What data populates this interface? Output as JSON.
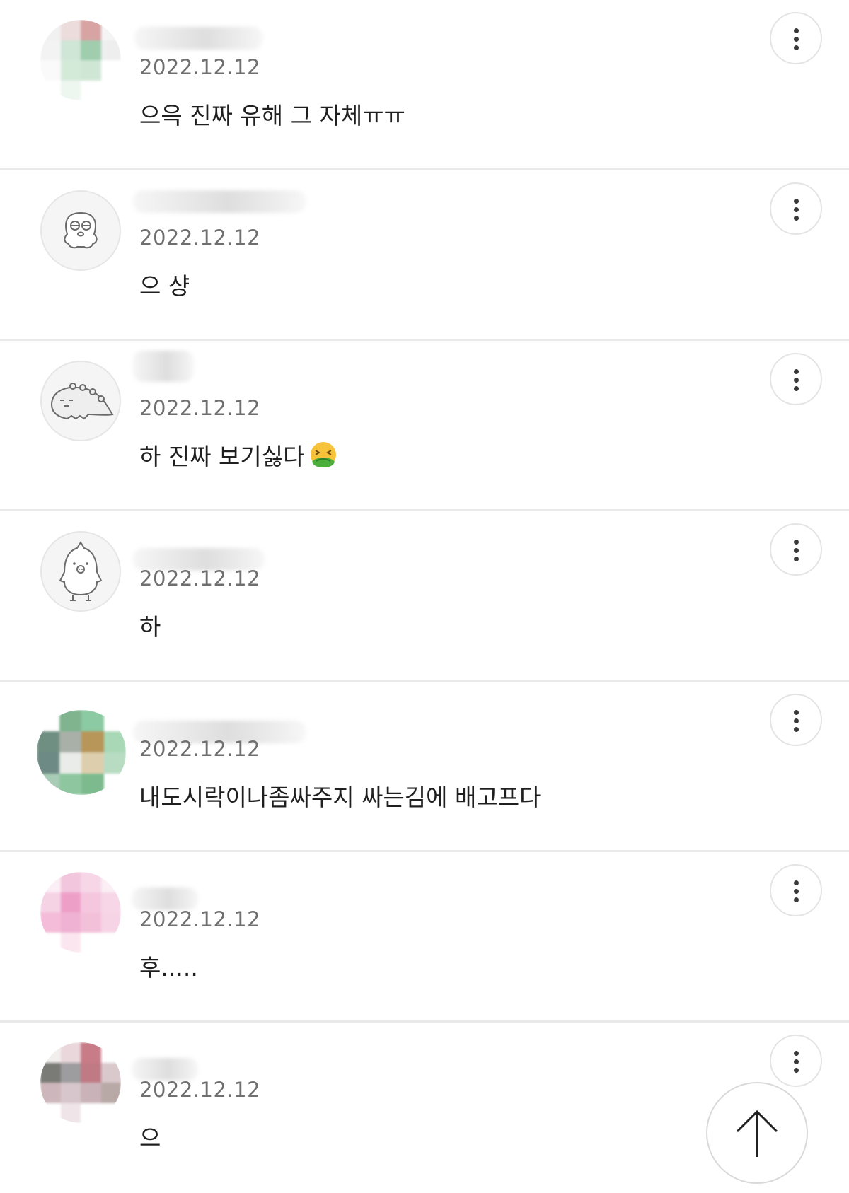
{
  "comments": [
    {
      "avatar": "photo-mosaic-green-red",
      "nickname_hidden": true,
      "date": "2022.12.12",
      "text": "으윽 진짜 유해 그 자체ㅠㅠ"
    },
    {
      "avatar": "character-face-icon",
      "nickname_hidden": true,
      "date": "2022.12.12",
      "text": "으 샹"
    },
    {
      "avatar": "character-dino-icon",
      "nickname_hidden": true,
      "date": "2022.12.12",
      "text": "하 진짜 보기싫다",
      "emoji": "nauseated-face-emoji"
    },
    {
      "avatar": "character-penguin-icon",
      "nickname_hidden": true,
      "date": "2022.12.12",
      "text": "하"
    },
    {
      "avatar": "photo-mosaic-green-tan",
      "nickname_hidden": true,
      "date": "2022.12.12",
      "text": "내도시락이나좀싸주지 싸는김에 배고프다"
    },
    {
      "avatar": "photo-mosaic-pink",
      "nickname_hidden": true,
      "date": "2022.12.12",
      "text": "후....."
    },
    {
      "avatar": "photo-mosaic-gray-rose",
      "nickname_hidden": true,
      "date": "2022.12.12",
      "text": "으"
    }
  ],
  "icons": {
    "more": "vertical-dots-icon",
    "scroll_top": "arrow-up-icon"
  },
  "colors": {
    "background": "#ffffff",
    "divider": "#e9e9e9",
    "date_text": "#6f6f6f",
    "comment_text": "#1f1f1f"
  }
}
